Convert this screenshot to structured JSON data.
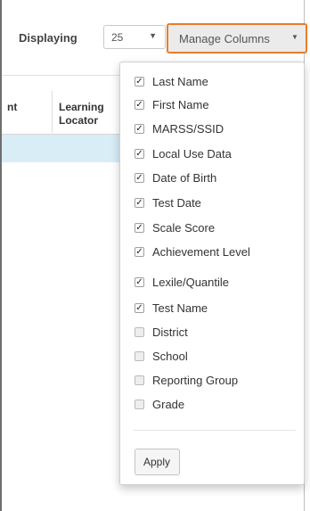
{
  "toolbar": {
    "display_label": "Displaying",
    "page_size_value": "25",
    "page_size_caret": "▼",
    "manage_columns_label": "Manage Columns",
    "manage_columns_caret": "▼"
  },
  "table": {
    "partial_header": "nt",
    "learning_locator_line1": "Learning",
    "learning_locator_line2": "Locator"
  },
  "columns_menu": {
    "items": [
      {
        "label": "Last Name",
        "checked": true
      },
      {
        "label": "First Name",
        "checked": true
      },
      {
        "label": "MARSS/SSID",
        "checked": true
      },
      {
        "label": "Local Use Data",
        "checked": true
      },
      {
        "label": "Date of Birth",
        "checked": true
      },
      {
        "label": "Test Date",
        "checked": true
      },
      {
        "label": "Scale Score",
        "checked": true
      },
      {
        "label": "Achievement Level",
        "checked": true
      },
      {
        "label": "Lexile/Quantile",
        "checked": true
      },
      {
        "label": "Test Name",
        "checked": true
      },
      {
        "label": "District",
        "checked": false
      },
      {
        "label": "School",
        "checked": false
      },
      {
        "label": "Reporting Group",
        "checked": false
      },
      {
        "label": "Grade",
        "checked": false
      }
    ],
    "apply_label": "Apply"
  },
  "colors": {
    "accent_border": "#e87d2b",
    "selected_row": "#d9edf7"
  }
}
